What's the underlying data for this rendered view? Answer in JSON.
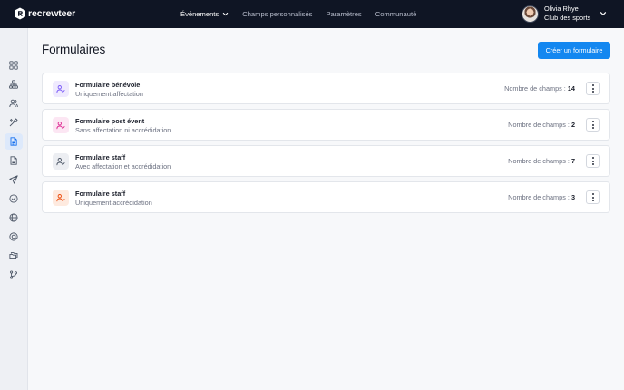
{
  "app": {
    "brand": "recrewteer"
  },
  "nav": {
    "items": [
      {
        "label": "Événements",
        "active": true,
        "has_dropdown": true
      },
      {
        "label": "Champs personnalisés",
        "active": false
      },
      {
        "label": "Paramètres",
        "active": false
      },
      {
        "label": "Communauté",
        "active": false
      }
    ]
  },
  "user": {
    "name": "Olivia Rhye",
    "club": "Club des sports"
  },
  "sidebar": {
    "items": [
      {
        "icon": "dashboard-grid-icon",
        "active": false
      },
      {
        "icon": "hierarchy-icon",
        "active": false
      },
      {
        "icon": "users-icon",
        "active": false
      },
      {
        "icon": "tools-icon",
        "active": false
      },
      {
        "icon": "document-icon",
        "active": true
      },
      {
        "icon": "file-text-icon",
        "active": false
      },
      {
        "icon": "send-icon",
        "active": false
      },
      {
        "icon": "check-circle-icon",
        "active": false
      },
      {
        "icon": "globe-icon",
        "active": false
      },
      {
        "icon": "at-sign-icon",
        "active": false
      },
      {
        "icon": "folders-icon",
        "active": false
      },
      {
        "icon": "git-branch-icon",
        "active": false
      }
    ]
  },
  "main": {
    "title": "Formulaires",
    "create_label": "Créer un formulaire",
    "count_label": "Nombre de champs :",
    "forms": [
      {
        "title": "Formulaire bénévole",
        "subtitle": "Uniquement affectation",
        "count": "14",
        "icon": "user-check-icon",
        "color": "#7a5af8",
        "bg": "#efeafe"
      },
      {
        "title": "Formulaire post évent",
        "subtitle": "Sans affectation ni accrédidation",
        "count": "2",
        "icon": "user-check-icon",
        "color": "#dd2590",
        "bg": "#fce6f3"
      },
      {
        "title": "Formulaire staff",
        "subtitle": "Avec affectation et accrédidation",
        "count": "7",
        "icon": "user-check-icon",
        "color": "#4b5565",
        "bg": "#eceef2"
      },
      {
        "title": "Formulaire staff",
        "subtitle": "Uniquement accrédidation",
        "count": "3",
        "icon": "user-check-icon",
        "color": "#ec4a0a",
        "bg": "#feeadf"
      }
    ]
  }
}
